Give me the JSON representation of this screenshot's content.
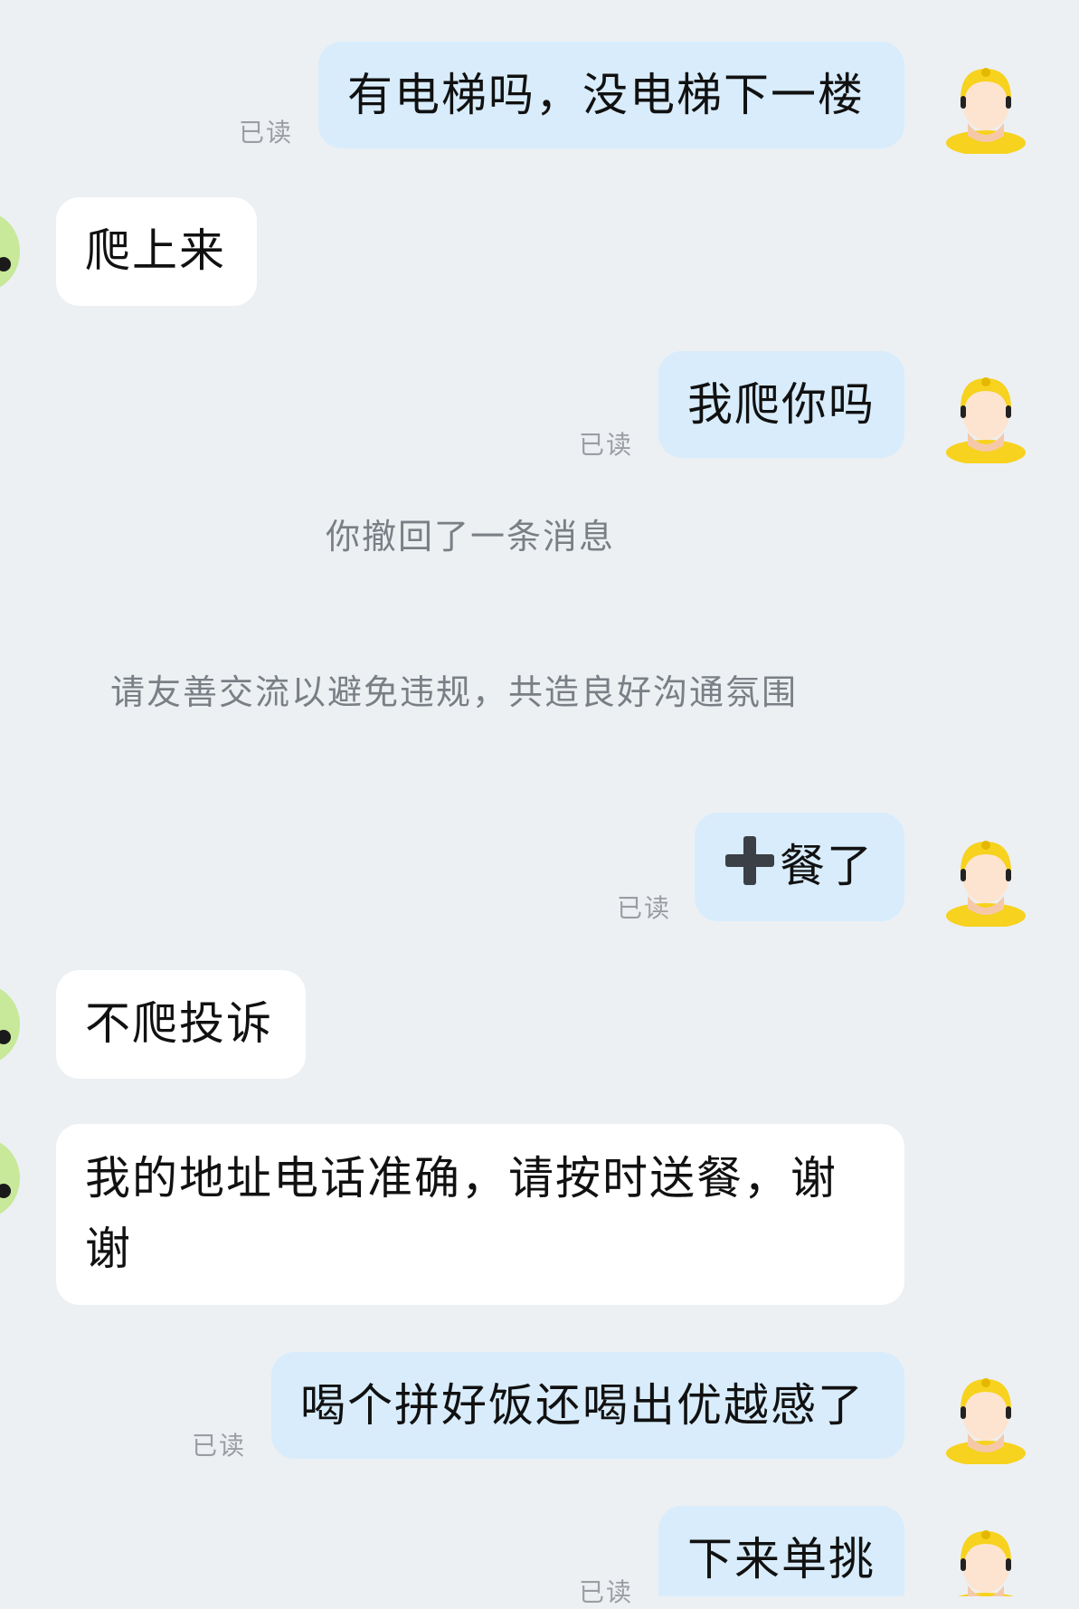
{
  "read_label": "已读",
  "messages": [
    {
      "side": "out",
      "text": "有电梯吗，没电梯下一楼",
      "status": "已读"
    },
    {
      "side": "in",
      "text": "爬上来"
    },
    {
      "side": "out",
      "text": "我爬你吗",
      "status": "已读"
    },
    {
      "side": "out",
      "prefix_icon": "heavy-plus-icon",
      "text": "餐了",
      "status": "已读"
    },
    {
      "side": "in",
      "text": "不爬投诉"
    },
    {
      "side": "in",
      "text": "我的地址电话准确，请按时送餐，谢谢"
    },
    {
      "side": "out",
      "text": "喝个拼好饭还喝出优越感了",
      "status": "已读"
    },
    {
      "side": "out",
      "text": "下来单挑",
      "status": "已读"
    }
  ],
  "system_notices": {
    "recall": "你撤回了一条消息",
    "warning": "请友善交流以避免违规，共造良好沟通氛围"
  },
  "colors": {
    "background": "#ecf0f3",
    "outgoing_bubble": "#d8ecfb",
    "incoming_bubble": "#ffffff",
    "rider_helmet": "#f7d21e",
    "incoming_avatar": "#9bd14a"
  }
}
